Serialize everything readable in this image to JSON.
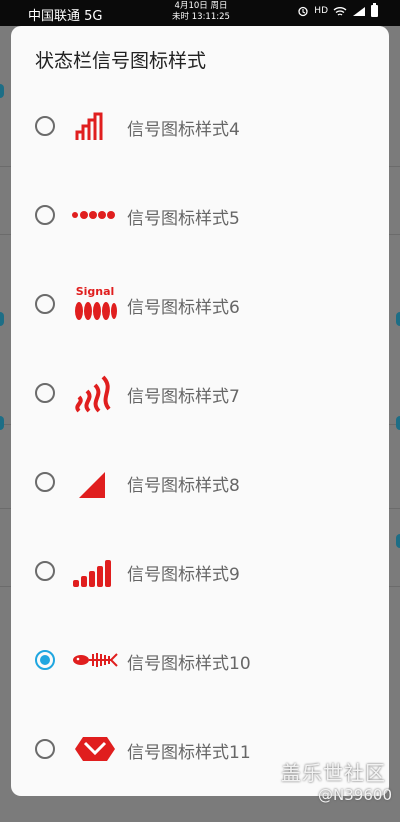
{
  "status_bar": {
    "carrier": "中国联通 5G",
    "date": "4月10日 周日",
    "time": "未时 13:11:25",
    "icons": [
      "alarm-icon",
      "hd-icon",
      "wifi-icon",
      "signal-icon",
      "battery-icon"
    ],
    "hd_label": "HD"
  },
  "dialog": {
    "title": "状态栏信号图标样式",
    "options": [
      {
        "label": "信号图标样式4",
        "checked": false,
        "icon": "signal-style-4-icon"
      },
      {
        "label": "信号图标样式5",
        "checked": false,
        "icon": "signal-style-5-icon"
      },
      {
        "label": "信号图标样式6",
        "checked": false,
        "icon": "signal-style-6-icon"
      },
      {
        "label": "信号图标样式7",
        "checked": false,
        "icon": "signal-style-7-icon"
      },
      {
        "label": "信号图标样式8",
        "checked": false,
        "icon": "signal-style-8-icon"
      },
      {
        "label": "信号图标样式9",
        "checked": false,
        "icon": "signal-style-9-icon"
      },
      {
        "label": "信号图标样式10",
        "checked": true,
        "icon": "signal-style-10-icon"
      },
      {
        "label": "信号图标样式11",
        "checked": false,
        "icon": "signal-style-11-icon"
      }
    ],
    "accent_color": "#1fa6e0",
    "icon_color": "#e01e1e",
    "style6_icon_text": "Signal"
  },
  "watermark": {
    "line1": "盖乐世社区",
    "line2": "@N39600"
  }
}
